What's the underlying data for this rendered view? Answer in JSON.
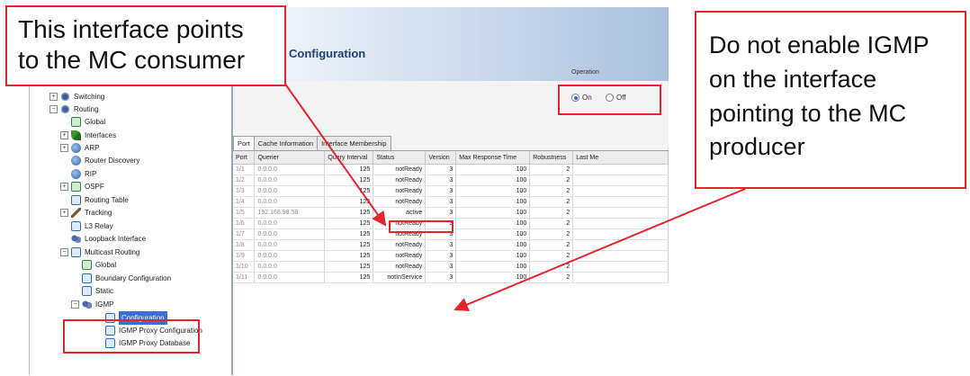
{
  "callouts": {
    "left": [
      "This interface points",
      "to the MC consumer"
    ],
    "right": [
      "Do not enable IGMP",
      "on the interface",
      "pointing to the MC",
      "producer"
    ]
  },
  "colors": {
    "annotation": "#e5242c",
    "selection": "#3b6fd1",
    "title": "#1e3f78"
  },
  "tree": {
    "items": [
      {
        "label": "Switching",
        "icon": "switch-icon"
      },
      {
        "label": "Routing",
        "icon": "routing-icon"
      },
      {
        "label": "Global",
        "icon": "global-icon"
      },
      {
        "label": "Interfaces",
        "icon": "interfaces-icon"
      },
      {
        "label": "ARP",
        "icon": "arp-icon"
      },
      {
        "label": "Router Discovery",
        "icon": "router-discovery-icon"
      },
      {
        "label": "RIP",
        "icon": "rip-icon"
      },
      {
        "label": "OSPF",
        "icon": "ospf-icon"
      },
      {
        "label": "Routing Table",
        "icon": "table-icon"
      },
      {
        "label": "Tracking",
        "icon": "tracking-icon"
      },
      {
        "label": "L3 Relay",
        "icon": "relay-icon"
      },
      {
        "label": "Loopback Interface",
        "icon": "loopback-icon"
      },
      {
        "label": "Multicast Routing",
        "icon": "multicast-icon"
      },
      {
        "label": "Global",
        "icon": "global-icon"
      },
      {
        "label": "Boundary Configuration",
        "icon": "boundary-icon"
      },
      {
        "label": "Static",
        "icon": "static-icon"
      },
      {
        "label": "IGMP",
        "icon": "igmp-icon"
      },
      {
        "label": "Configuration",
        "icon": "configuration-icon"
      },
      {
        "label": "IGMP Proxy Configuration",
        "icon": "proxy-config-icon"
      },
      {
        "label": "IGMP Proxy Database",
        "icon": "proxy-database-icon"
      }
    ]
  },
  "main": {
    "title": "Configuration",
    "operation": {
      "label": "Operation",
      "on": "On",
      "off": "Off",
      "selected": "On"
    },
    "tabs": [
      "Port",
      "Cache Information",
      "Interface Membership"
    ],
    "active_tab": "Port",
    "columns": [
      "Port",
      "Querier",
      "Query Interval",
      "Status",
      "Version",
      "Max Response Time",
      "Robustness",
      "Last Me"
    ],
    "rows": [
      [
        "1/1",
        "0.0.0.0",
        "125",
        "notReady",
        "3",
        "100",
        "2"
      ],
      [
        "1/2",
        "0.0.0.0",
        "125",
        "notReady",
        "3",
        "100",
        "2"
      ],
      [
        "1/3",
        "0.0.0.0",
        "125",
        "notReady",
        "3",
        "100",
        "2"
      ],
      [
        "1/4",
        "0.0.0.0",
        "125",
        "notReady",
        "3",
        "100",
        "2"
      ],
      [
        "1/5",
        "192.168.99.58",
        "125",
        "active",
        "3",
        "100",
        "2"
      ],
      [
        "1/6",
        "0.0.0.0",
        "125",
        "notReady",
        "3",
        "100",
        "2"
      ],
      [
        "1/7",
        "0.0.0.0",
        "125",
        "notReady",
        "3",
        "100",
        "2"
      ],
      [
        "1/8",
        "0.0.0.0",
        "125",
        "notReady",
        "3",
        "100",
        "2"
      ],
      [
        "1/9",
        "0.0.0.0",
        "125",
        "notReady",
        "3",
        "100",
        "2"
      ],
      [
        "1/10",
        "0.0.0.0",
        "125",
        "notReady",
        "3",
        "100",
        "2"
      ],
      [
        "1/11",
        "0.0.0.0",
        "125",
        "notInService",
        "3",
        "100",
        "2"
      ]
    ]
  }
}
